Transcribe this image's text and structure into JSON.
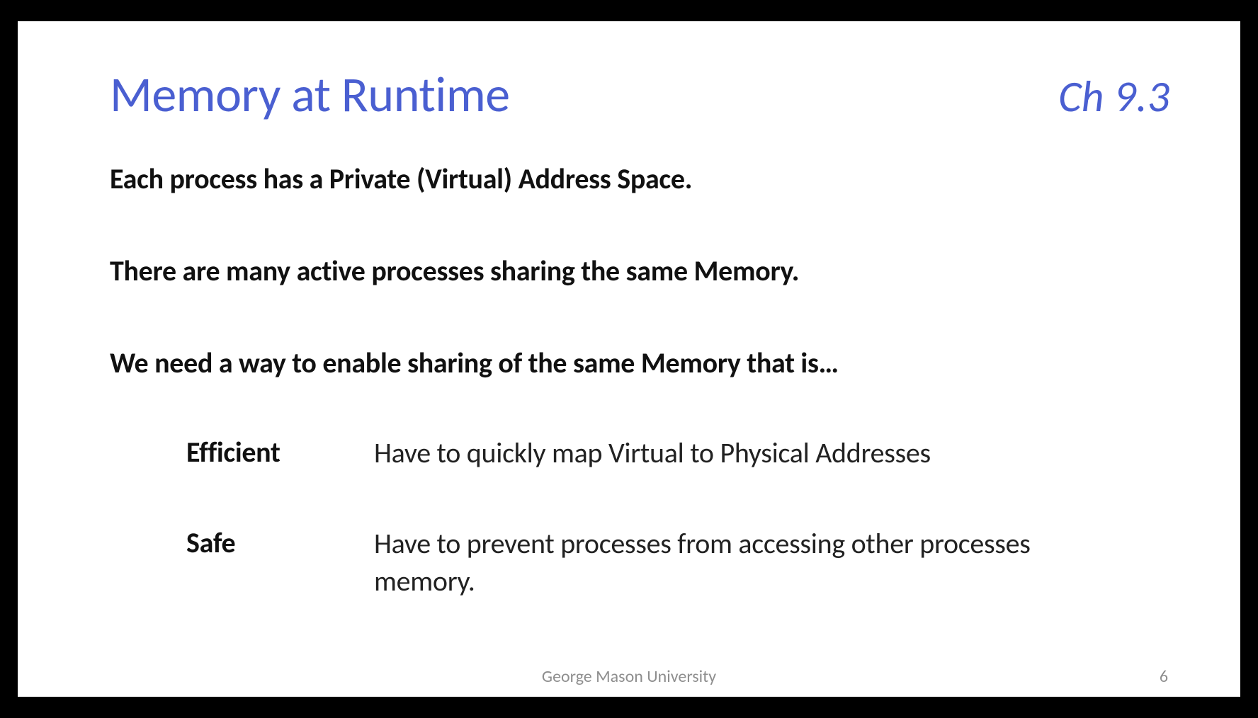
{
  "title": "Memory at Runtime",
  "chapter": "Ch 9.3",
  "lines": {
    "l1": "Each process has a Private (Virtual) Address Space.",
    "l2": "There are many active processes sharing the same Memory.",
    "l3": "We need a way to enable sharing of the same Memory that is…"
  },
  "rows": {
    "efficient": {
      "label": "Efficient",
      "desc": "Have to quickly map Virtual to Physical Addresses"
    },
    "safe": {
      "label": "Safe",
      "desc": "Have to prevent processes from accessing other processes memory."
    }
  },
  "footer": {
    "org": "George Mason University",
    "page": "6"
  }
}
